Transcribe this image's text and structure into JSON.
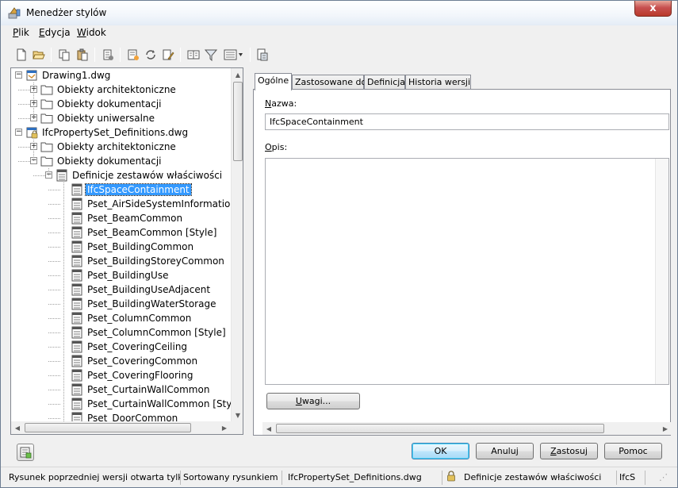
{
  "window": {
    "title": "Menedżer stylów",
    "close_glyph": "x"
  },
  "menu": [
    {
      "mnemonic": "P",
      "rest": "lik"
    },
    {
      "mnemonic": "E",
      "rest": "dycja"
    },
    {
      "mnemonic": "W",
      "rest": "idok"
    }
  ],
  "toolbar_icons": [
    "new-icon",
    "open-icon",
    "copy-icon",
    "paste-icon",
    "purge-icon",
    "new-style-icon",
    "sync-icon",
    "edit-style-icon",
    "browse-icon",
    "filter-icon",
    "view-mode-icon",
    "toggle-view-icon"
  ],
  "tree": {
    "items": [
      {
        "label": "Drawing1.dwg",
        "level": 0,
        "icon": "drawing-icon",
        "expander": "−"
      },
      {
        "label": "Obiekty architektoniczne",
        "level": 1,
        "icon": "folder-icon",
        "expander": "+"
      },
      {
        "label": "Obiekty dokumentacji",
        "level": 1,
        "icon": "folder-icon",
        "expander": "+"
      },
      {
        "label": "Obiekty uniwersalne",
        "level": 1,
        "icon": "folder-icon",
        "expander": "+"
      },
      {
        "label": "IfcPropertySet_Definitions.dwg",
        "level": 0,
        "icon": "locked-drawing-icon",
        "expander": "−"
      },
      {
        "label": "Obiekty architektoniczne",
        "level": 1,
        "icon": "folder-icon",
        "expander": "+"
      },
      {
        "label": "Obiekty dokumentacji",
        "level": 1,
        "icon": "folder-icon",
        "expander": "−"
      },
      {
        "label": "Definicje zestawów właściwości",
        "level": 2,
        "icon": "property-set-folder-icon",
        "expander": "−"
      },
      {
        "label": "IfcSpaceContainment",
        "level": 3,
        "icon": "property-set-icon",
        "selected": true
      },
      {
        "label": "Pset_AirSideSystemInformation",
        "level": 3,
        "icon": "property-set-icon"
      },
      {
        "label": "Pset_BeamCommon",
        "level": 3,
        "icon": "property-set-icon"
      },
      {
        "label": "Pset_BeamCommon [Style]",
        "level": 3,
        "icon": "property-set-icon"
      },
      {
        "label": "Pset_BuildingCommon",
        "level": 3,
        "icon": "property-set-icon"
      },
      {
        "label": "Pset_BuildingStoreyCommon",
        "level": 3,
        "icon": "property-set-icon"
      },
      {
        "label": "Pset_BuildingUse",
        "level": 3,
        "icon": "property-set-icon"
      },
      {
        "label": "Pset_BuildingUseAdjacent",
        "level": 3,
        "icon": "property-set-icon"
      },
      {
        "label": "Pset_BuildingWaterStorage",
        "level": 3,
        "icon": "property-set-icon"
      },
      {
        "label": "Pset_ColumnCommon",
        "level": 3,
        "icon": "property-set-icon"
      },
      {
        "label": "Pset_ColumnCommon [Style]",
        "level": 3,
        "icon": "property-set-icon"
      },
      {
        "label": "Pset_CoveringCeiling",
        "level": 3,
        "icon": "property-set-icon"
      },
      {
        "label": "Pset_CoveringCommon",
        "level": 3,
        "icon": "property-set-icon"
      },
      {
        "label": "Pset_CoveringFlooring",
        "level": 3,
        "icon": "property-set-icon"
      },
      {
        "label": "Pset_CurtainWallCommon",
        "level": 3,
        "icon": "property-set-icon"
      },
      {
        "label": "Pset_CurtainWallCommon [Style]",
        "level": 3,
        "icon": "property-set-icon"
      },
      {
        "label": "Pset_DoorCommon",
        "level": 3,
        "icon": "property-set-icon"
      }
    ]
  },
  "tabs": [
    {
      "label": "Ogólne",
      "active": true
    },
    {
      "label": "Zastosowane do",
      "active": false
    },
    {
      "label": "Definicja",
      "active": false
    },
    {
      "label": "Historia wersji",
      "active": false
    }
  ],
  "general": {
    "name_label_mnemonic": "N",
    "name_label_rest": "azwa:",
    "name_value": "IfcSpaceContainment",
    "desc_label_mnemonic": "O",
    "desc_label_rest": "pis:",
    "desc_value": "",
    "notes_button_mnemonic": "U",
    "notes_button_rest": "wagi..."
  },
  "buttons": {
    "ok": "OK",
    "cancel": "Anuluj",
    "apply_mnemonic": "Z",
    "apply_rest": "astosuj",
    "help": "Pomoc"
  },
  "status": {
    "cell1": "Rysunek poprzedniej wersji otwarta tylko",
    "cell2": "Sortowany rysunkiem",
    "cell3": "IfcPropertySet_Definitions.dwg",
    "cell4": "Definicje zestawów właściwości",
    "cell5": "IfcS"
  },
  "colors": {
    "selection": "#3399ff",
    "close": "#c75050"
  }
}
